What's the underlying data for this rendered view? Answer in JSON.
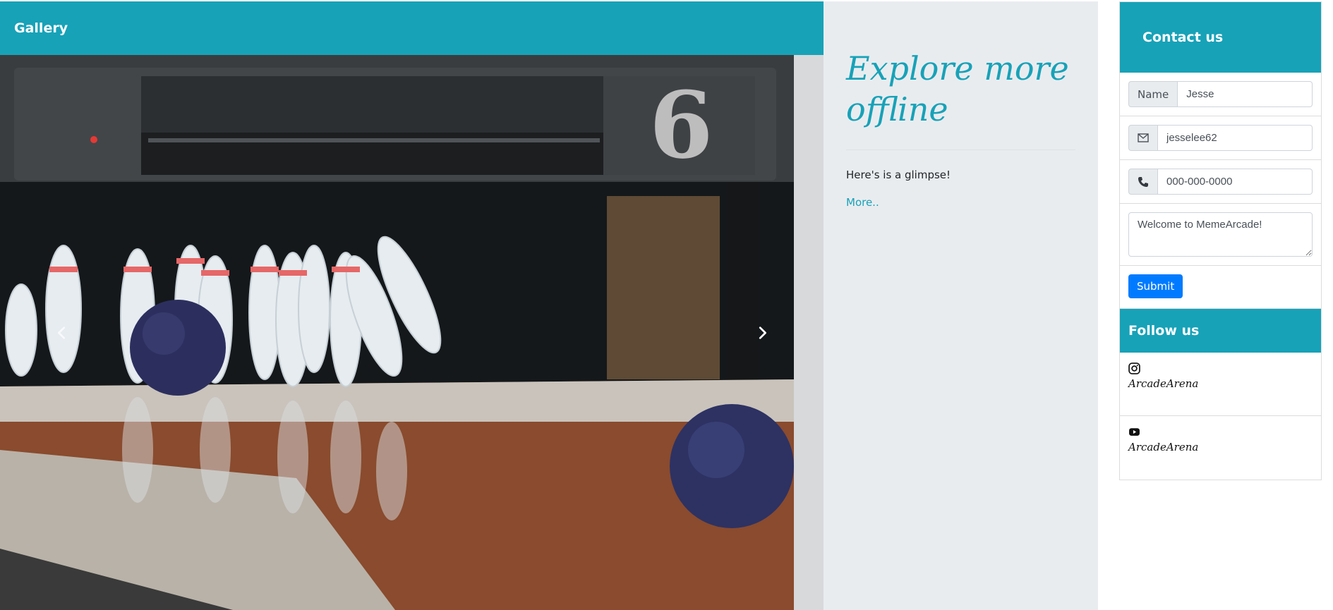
{
  "gallery": {
    "title": "Gallery",
    "slide_number": "6",
    "prev_label": "Previous",
    "next_label": "Next"
  },
  "explore": {
    "heading": "Explore more offline",
    "text": "Here's is a glimpse!",
    "link": "More.."
  },
  "contact": {
    "title": "Contact us",
    "name_label": "Name",
    "name_value": "Jesse",
    "email_value": "jesselee62",
    "phone_placeholder": "000-000-0000",
    "message_value": "Welcome to MemeArcade!",
    "submit_label": "Submit"
  },
  "follow": {
    "title": "Follow us",
    "items": [
      {
        "icon": "instagram-icon",
        "handle": "ArcadeArena"
      },
      {
        "icon": "youtube-icon",
        "handle": "ArcadeArena"
      }
    ]
  },
  "colors": {
    "accent": "#17a2b8",
    "panel": "#e9ecef",
    "primary": "#007bff"
  }
}
